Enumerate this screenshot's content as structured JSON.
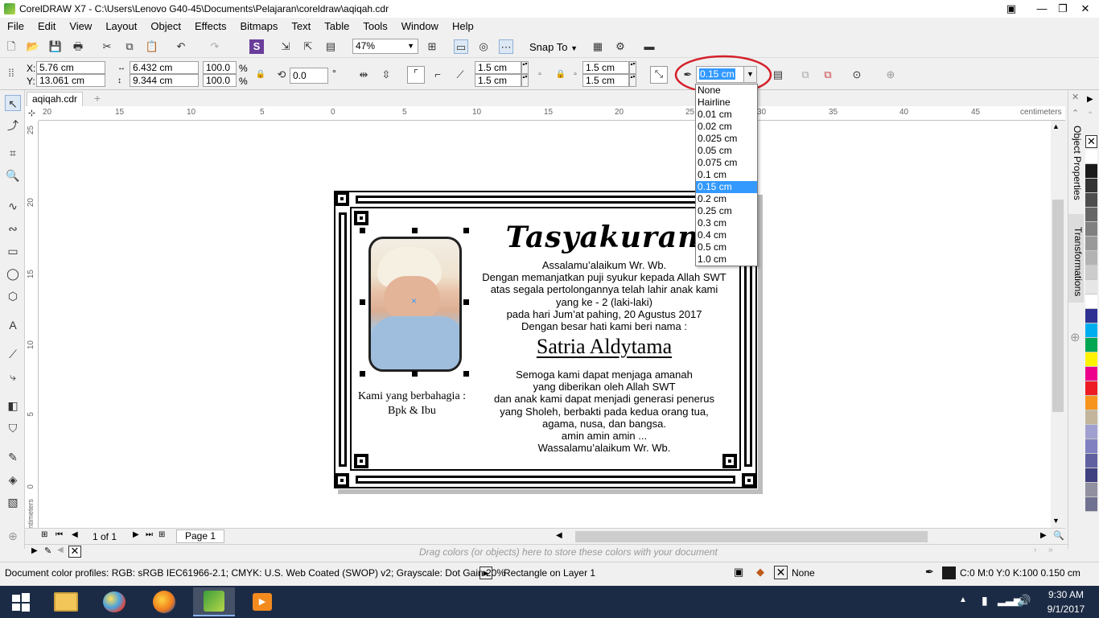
{
  "window": {
    "title": "CorelDRAW X7 - C:\\Users\\Lenovo G40-45\\Documents\\Pelajaran\\coreldraw\\aqiqah.cdr"
  },
  "menu": [
    "File",
    "Edit",
    "View",
    "Layout",
    "Object",
    "Effects",
    "Bitmaps",
    "Text",
    "Table",
    "Tools",
    "Window",
    "Help"
  ],
  "toolbar": {
    "zoom": "47%",
    "snap_to": "Snap To"
  },
  "properties": {
    "x_label": "X:",
    "x": "5.76 cm",
    "y_label": "Y:",
    "y": "13.061 cm",
    "width": "6.432 cm",
    "height": "9.344 cm",
    "scale_w": "100.0",
    "scale_h": "100.0",
    "pct": "%",
    "rotation": "0.0",
    "degree": "°",
    "corner_tl": "1.5 cm",
    "corner_bl": "1.5 cm",
    "corner_tr": "1.5 cm",
    "corner_br": "1.5 cm",
    "outline_width": "0.15 cm"
  },
  "outline_options": [
    "None",
    "Hairline",
    "0.01 cm",
    "0.02 cm",
    "0.025 cm",
    "0.05 cm",
    "0.075 cm",
    "0.1 cm",
    "0.15 cm",
    "0.2 cm",
    "0.25 cm",
    "0.3 cm",
    "0.4 cm",
    "0.5 cm",
    "1.0 cm"
  ],
  "outline_selected_index": 8,
  "doc_tab": "aqiqah.cdr",
  "ruler": {
    "h_ticks": [
      "20",
      "15",
      "10",
      "5",
      "0",
      "5",
      "10",
      "15",
      "20",
      "25",
      "30",
      "35",
      "40",
      "45"
    ],
    "h_unit": "centimeters",
    "v_ticks": [
      "25",
      "20",
      "15",
      "10",
      "5",
      "0"
    ],
    "v_unit": "centimeters"
  },
  "card": {
    "title": "Tasyakuran",
    "greeting": "Assalamu’alaikum Wr. Wb.",
    "lines": [
      "Dengan memanjatkan puji syukur kepada Allah SWT",
      "atas segala pertolongannya telah lahir anak kami",
      "yang ke - 2 (laki-laki)",
      "pada hari Jum’at pahing, 20 Agustus 2017",
      "Dengan besar hati kami beri nama :"
    ],
    "baby_name": "Satria Aldytama",
    "closing": [
      "Semoga kami dapat menjaga amanah",
      "yang diberikan oleh Allah SWT",
      "dan anak kami dapat menjadi generasi penerus",
      "yang Sholeh, berbakti pada kedua orang tua,",
      "agama, nusa, dan bangsa.",
      "amin amin amin ...",
      "Wassalamu’alaikum Wr. Wb."
    ],
    "parents_label": "Kami yang berbahagia :",
    "parents": "Bpk & Ibu"
  },
  "page_nav": {
    "count": "1 of 1",
    "page_tab": "Page 1"
  },
  "palette_hint": "Drag colors (or objects) here to store these colors with your document",
  "dockers": {
    "object_properties": "Object Properties",
    "transformations": "Transformations"
  },
  "status": {
    "profiles": "Document color profiles: RGB: sRGB IEC61966-2.1; CMYK: U.S. Web Coated (SWOP) v2; Grayscale: Dot Gain 20%",
    "selection": "Rectangle on Layer 1",
    "fill": "None",
    "outline": "C:0 M:0 Y:0 K:100  0.150 cm"
  },
  "clock": {
    "time": "9:30 AM",
    "date": "9/1/2017"
  },
  "colors": {
    "accent": "#3399ff",
    "highlight_circle": "#d4202a",
    "taskbar": "#1c2b45",
    "swatches": [
      "#ffffff",
      "#1a1a1a",
      "#333333",
      "#4d4d4d",
      "#666666",
      "#808080",
      "#999999",
      "#b3b3b3",
      "#cccccc",
      "#e6e6e6",
      "#ffffff",
      "#2e3192",
      "#00aeef",
      "#00a651",
      "#fff200",
      "#ec008c",
      "#ed1c24",
      "#f7941d",
      "#c2b59b",
      "#a0a0d0",
      "#8080c0",
      "#6060a0",
      "#404080",
      "#9090a0",
      "#707090"
    ]
  }
}
